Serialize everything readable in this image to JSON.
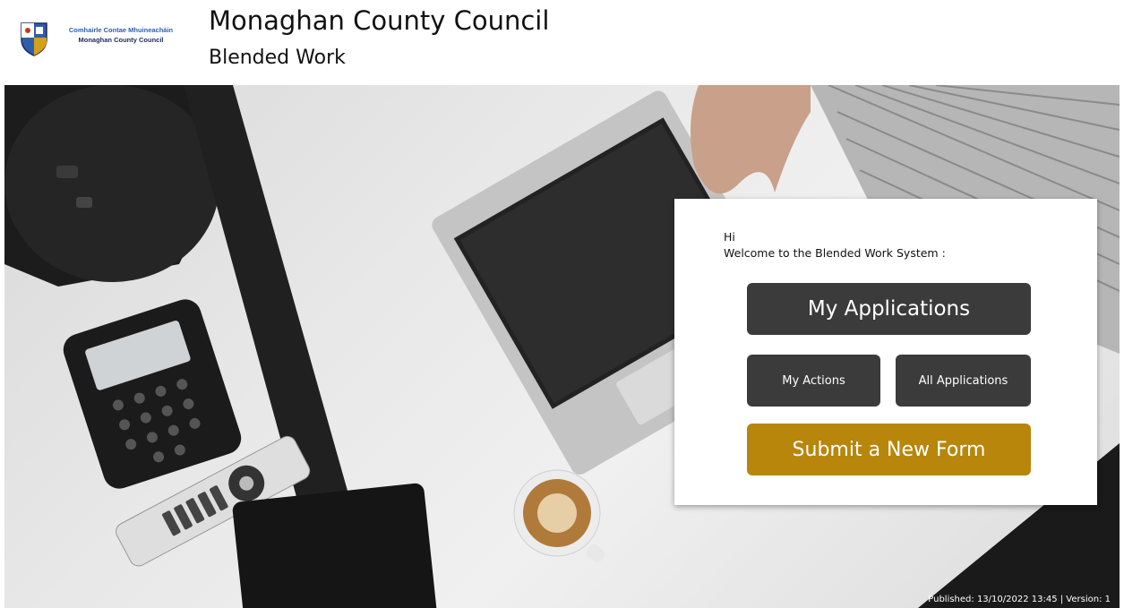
{
  "header": {
    "logo_line1": "Comhairle Contae Mhuineacháin",
    "logo_line2": "Monaghan County Council",
    "title": "Monaghan County Council",
    "subtitle": "Blended Work"
  },
  "card": {
    "greeting": "Hi",
    "welcome": "Welcome to the Blended Work System :",
    "buttons": {
      "my_applications": "My Applications",
      "my_actions": "My Actions",
      "all_applications": "All Applications",
      "submit_new_form": "Submit a New Form"
    }
  },
  "footer": {
    "published": "Published: 13/10/2022 13:45 | Version: 1"
  },
  "colors": {
    "dark_button": "#3b3b3b",
    "gold_button": "#b8860b"
  }
}
